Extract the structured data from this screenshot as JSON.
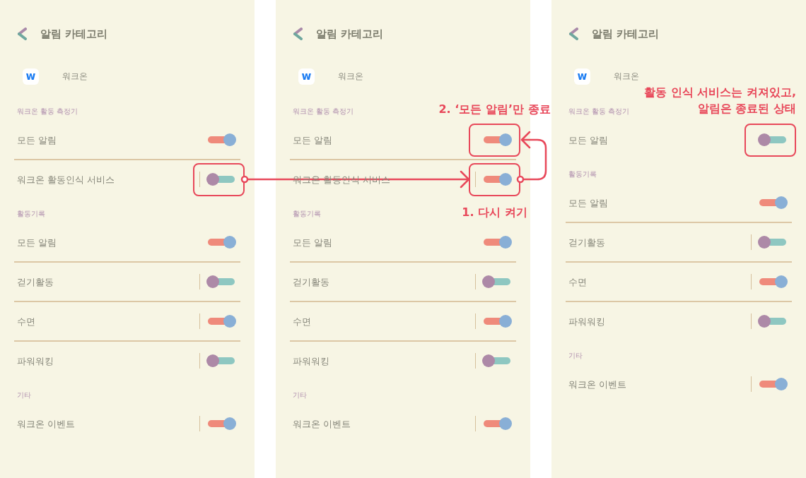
{
  "panels": [
    {
      "header": {
        "title": "알림 카테고리"
      },
      "app": {
        "logo": "w",
        "name": "워크온"
      },
      "groups": [
        {
          "label": "워크온 활동 측정기",
          "rows": [
            {
              "label": "모든 알림",
              "kind": "plain",
              "on": true,
              "highlighted": false
            },
            {
              "label": "워크온 활동인식 서비스",
              "kind": "split",
              "on": false,
              "highlighted": true
            }
          ]
        },
        {
          "label": "활동기록",
          "rows": [
            {
              "label": "모든 알림",
              "kind": "plain",
              "on": true,
              "highlighted": false
            },
            {
              "label": "걷기활동",
              "kind": "split",
              "on": false,
              "highlighted": false
            },
            {
              "label": "수면",
              "kind": "split",
              "on": true,
              "highlighted": false
            },
            {
              "label": "파워워킹",
              "kind": "split",
              "on": false,
              "highlighted": false
            }
          ]
        },
        {
          "label": "기타",
          "rows": [
            {
              "label": "워크온 이벤트",
              "kind": "split",
              "on": true,
              "highlighted": false
            }
          ]
        }
      ]
    },
    {
      "header": {
        "title": "알림 카테고리"
      },
      "app": {
        "logo": "w",
        "name": "워크온"
      },
      "groups": [
        {
          "label": "워크온 활동 측정기",
          "rows": [
            {
              "label": "모든 알림",
              "kind": "plain",
              "on": true,
              "highlighted": true,
              "note": {
                "lines": [
                  "2. ‘모든 알림’만 종료"
                ],
                "kind": "above"
              }
            },
            {
              "label": "워크온 활동인식 서비스",
              "kind": "split",
              "on": true,
              "highlighted": true,
              "note": {
                "lines": [
                  "1. 다시 켜기"
                ],
                "kind": "below"
              }
            }
          ]
        },
        {
          "label": "활동기록",
          "rows": [
            {
              "label": "모든 알림",
              "kind": "plain",
              "on": true,
              "highlighted": false
            },
            {
              "label": "걷기활동",
              "kind": "split",
              "on": false,
              "highlighted": false
            },
            {
              "label": "수면",
              "kind": "split",
              "on": true,
              "highlighted": false
            },
            {
              "label": "파워워킹",
              "kind": "split",
              "on": false,
              "highlighted": false
            }
          ]
        },
        {
          "label": "기타",
          "rows": [
            {
              "label": "워크온 이벤트",
              "kind": "split",
              "on": true,
              "highlighted": false
            }
          ]
        }
      ]
    },
    {
      "header": {
        "title": "알림 카테고리"
      },
      "app": {
        "logo": "w",
        "name": "워크온"
      },
      "groups": [
        {
          "label": "워크온 활동 측정기",
          "rows": [
            {
              "label": "모든 알림",
              "kind": "plain",
              "on": false,
              "highlighted": true,
              "note": {
                "lines": [
                  "활동 인식 서비스는 켜져있고,",
                  "알림은 종료된 상태"
                ],
                "kind": "above"
              }
            }
          ]
        },
        {
          "label": "활동기록",
          "rows": [
            {
              "label": "모든 알림",
              "kind": "plain",
              "on": true,
              "highlighted": false
            },
            {
              "label": "걷기활동",
              "kind": "split",
              "on": false,
              "highlighted": false
            },
            {
              "label": "수면",
              "kind": "split",
              "on": true,
              "highlighted": false
            },
            {
              "label": "파워워킹",
              "kind": "split",
              "on": false,
              "highlighted": false
            }
          ]
        },
        {
          "label": "기타",
          "rows": [
            {
              "label": "워크온 이벤트",
              "kind": "split",
              "on": true,
              "highlighted": false
            }
          ]
        }
      ]
    }
  ]
}
